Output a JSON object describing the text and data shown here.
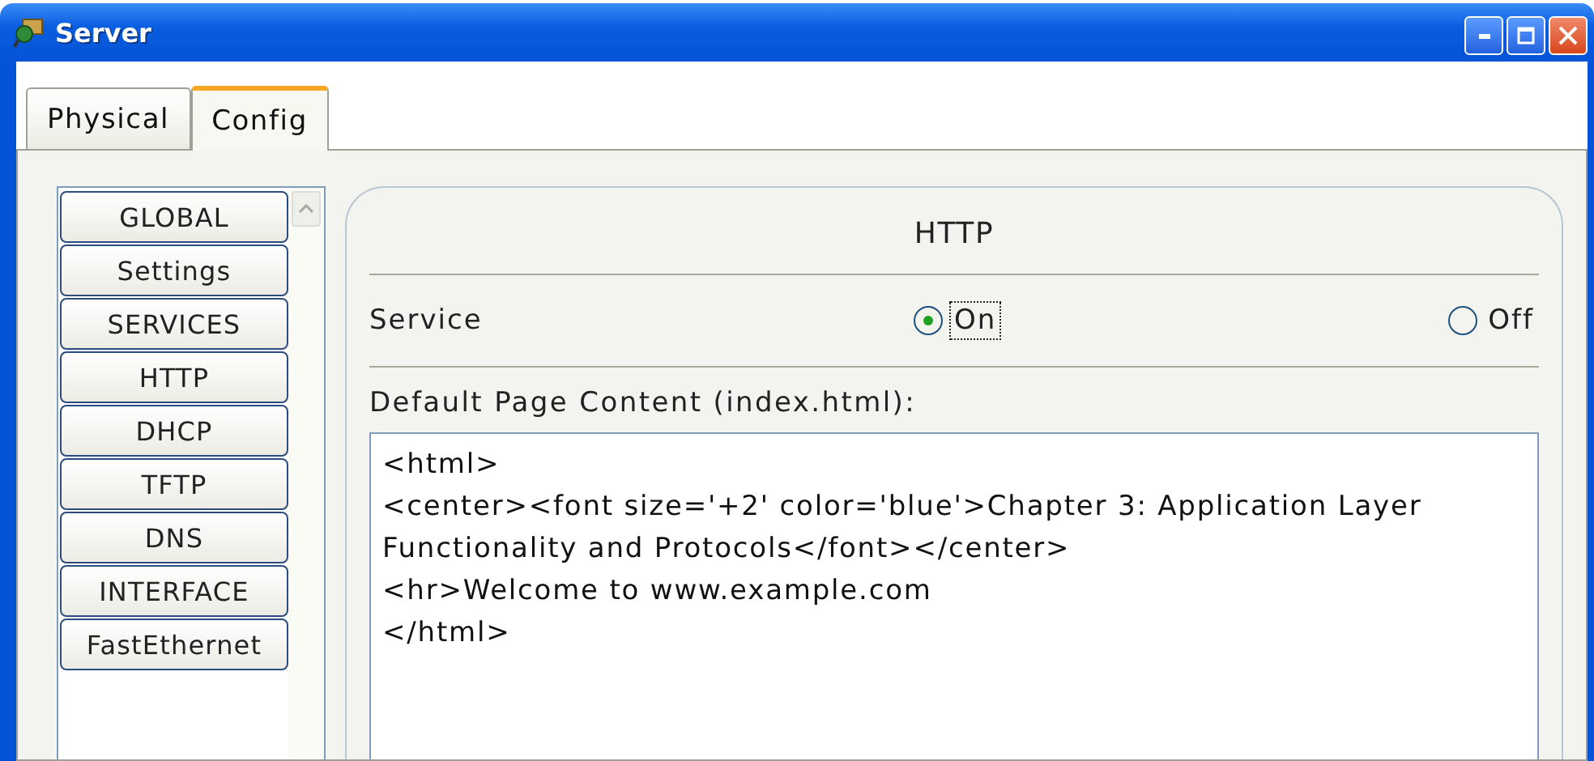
{
  "window": {
    "title": "Server"
  },
  "tabs": [
    {
      "label": "Physical",
      "selected": false
    },
    {
      "label": "Config",
      "selected": true
    }
  ],
  "sidebar": {
    "items": [
      "GLOBAL",
      "Settings",
      "SERVICES",
      "HTTP",
      "DHCP",
      "TFTP",
      "DNS",
      "INTERFACE",
      "FastEthernet"
    ]
  },
  "panel": {
    "title": "HTTP",
    "service": {
      "label": "Service",
      "options": [
        {
          "label": "On",
          "selected": true
        },
        {
          "label": "Off",
          "selected": false
        }
      ]
    },
    "content_label": "Default Page Content (index.html):",
    "content_value": "<html>\n<center><font size='+2' color='blue'>Chapter 3: Application Layer Functionality and Protocols</font></center>\n<hr>Welcome to www.example.com\n</html>"
  }
}
